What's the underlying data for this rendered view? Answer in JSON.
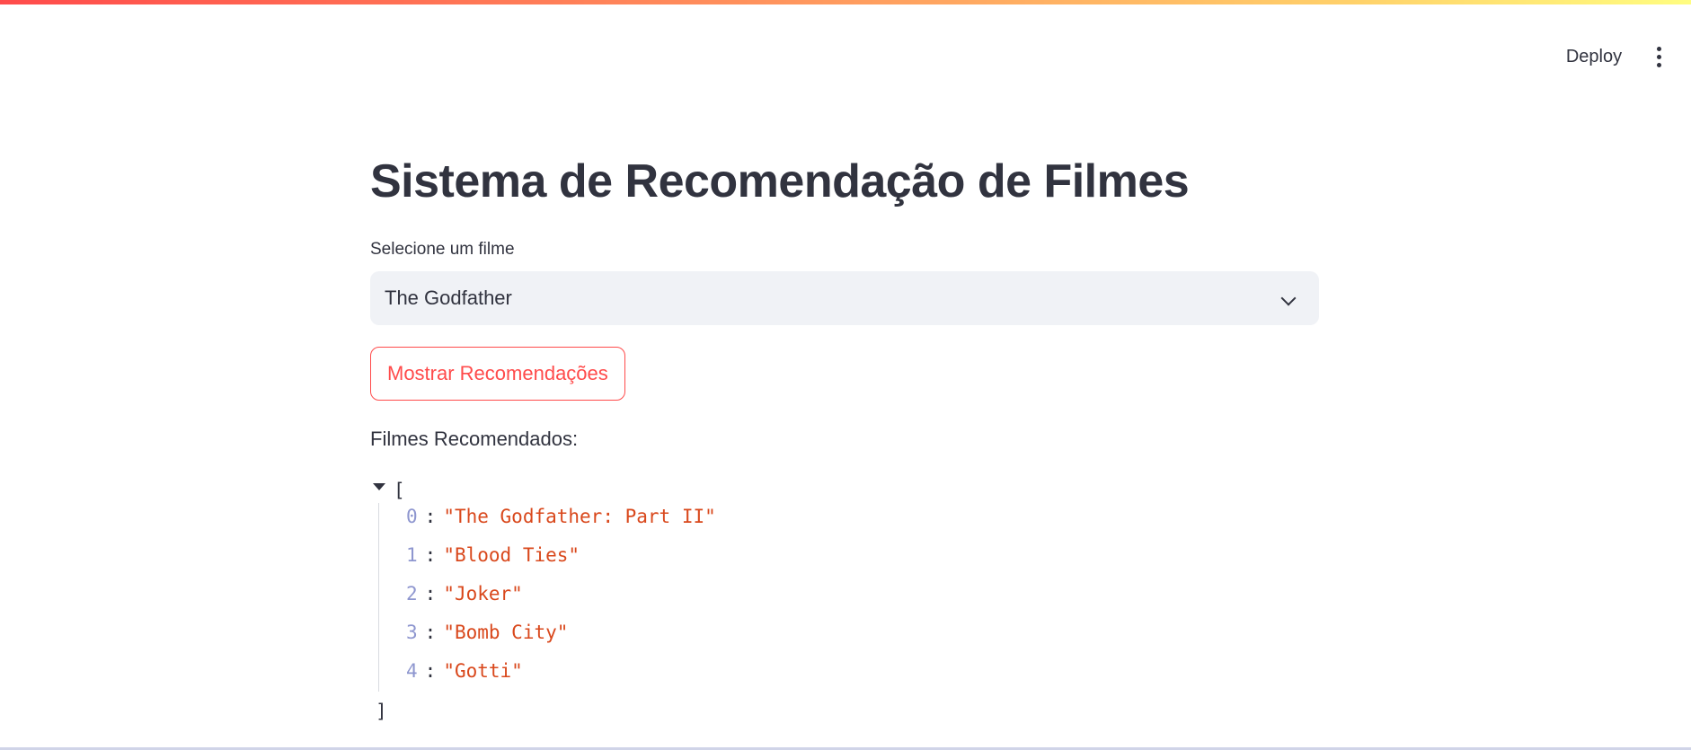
{
  "header": {
    "deploy_label": "Deploy",
    "menu_icon": "more-vertical-icon"
  },
  "main": {
    "title": "Sistema de Recomendação de Filmes",
    "select": {
      "label": "Selecione um filme",
      "value": "The Godfather",
      "icon": "chevron-down-icon"
    },
    "button_label": "Mostrar Recomendações",
    "results_label": "Filmes Recomendados:",
    "json": {
      "open_bracket": "[",
      "close_bracket": "]",
      "items": [
        {
          "key": "0",
          "value": "\"The Godfather: Part II\""
        },
        {
          "key": "1",
          "value": "\"Blood Ties\""
        },
        {
          "key": "2",
          "value": "\"Joker\""
        },
        {
          "key": "3",
          "value": "\"Bomb City\""
        },
        {
          "key": "4",
          "value": "\"Gotti\""
        }
      ]
    }
  },
  "colors": {
    "accent": "#ff4b4b",
    "text": "#31333f",
    "json_key": "#8e96cf",
    "json_string": "#d9481c",
    "select_bg": "#f0f2f6"
  }
}
